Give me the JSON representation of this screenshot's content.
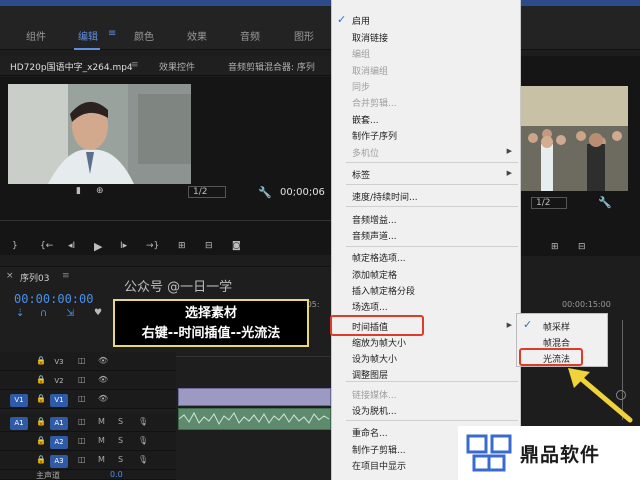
{
  "workspace": {
    "tabs": [
      "组件",
      "编辑",
      "颜色",
      "效果",
      "音频",
      "图形"
    ],
    "active_tab": "编辑",
    "accent": "#5f8fe0"
  },
  "source_panel": {
    "tabs": [
      "HD720p国语中字_x264.mp4",
      "效果控件",
      "音频剪辑混合器: 序列"
    ],
    "scale": "1/2",
    "timecode": "00;00;06"
  },
  "program_panel": {
    "scale": "1/2"
  },
  "sequence": {
    "name": "序列03",
    "timecode": "00:00:00:00",
    "ruler_mark_left": ":05:",
    "ruler_mark_right": "00:00:15:00",
    "tracks": [
      {
        "src": "",
        "label": "V3",
        "selected": false
      },
      {
        "src": "",
        "label": "V2",
        "selected": false
      },
      {
        "src": "V1",
        "label": "V1",
        "selected": true
      },
      {
        "src": "A1",
        "label": "A1",
        "selected": true
      },
      {
        "src": "",
        "label": "A2",
        "selected": true
      },
      {
        "src": "",
        "label": "A3",
        "selected": true
      }
    ],
    "master": "主声道",
    "master_value": "0.0",
    "mute_label": "M",
    "solo_label": "S"
  },
  "overlay": {
    "watermark": "公众号 @一日一学",
    "instruction_line1": "选择素材",
    "instruction_line2": "右键--时间插值--光流法"
  },
  "context_menu": {
    "items": [
      {
        "label": "启用",
        "checked": true,
        "disabled": false
      },
      {
        "label": "取消链接",
        "disabled": false
      },
      {
        "label": "编组",
        "disabled": true
      },
      {
        "label": "取消编组",
        "disabled": true
      },
      {
        "label": "同步",
        "disabled": true
      },
      {
        "label": "合并剪辑...",
        "disabled": true
      },
      {
        "label": "嵌套...",
        "disabled": false
      },
      {
        "label": "制作子序列",
        "disabled": false
      },
      {
        "label": "多机位",
        "disabled": true,
        "submenu": true
      },
      {
        "label": "标签",
        "disabled": false,
        "submenu": true
      },
      {
        "label": "速度/持续时间...",
        "disabled": false
      },
      {
        "label": "音频增益...",
        "disabled": false
      },
      {
        "label": "音频声道...",
        "disabled": false
      },
      {
        "label": "帧定格选项...",
        "disabled": false
      },
      {
        "label": "添加帧定格",
        "disabled": false
      },
      {
        "label": "插入帧定格分段",
        "disabled": false
      },
      {
        "label": "场选项...",
        "disabled": false
      },
      {
        "label": "时间插值",
        "disabled": false,
        "submenu": true,
        "highlighted": true
      },
      {
        "label": "缩放为帧大小",
        "disabled": false
      },
      {
        "label": "设为帧大小",
        "disabled": false
      },
      {
        "label": "调整图层",
        "disabled": false
      },
      {
        "label": "链接媒体...",
        "disabled": true
      },
      {
        "label": "设为脱机...",
        "disabled": false
      },
      {
        "label": "重命名...",
        "disabled": false
      },
      {
        "label": "制作子剪辑...",
        "disabled": false
      },
      {
        "label": "在项目中显示",
        "disabled": false
      }
    ]
  },
  "time_interp_submenu": {
    "items": [
      {
        "label": "帧采样",
        "checked": true
      },
      {
        "label": "帧混合",
        "checked": false
      },
      {
        "label": "光流法",
        "checked": false,
        "highlighted": true
      }
    ]
  },
  "brand": {
    "name": "鼎品软件",
    "color": "#3a6ad0"
  }
}
